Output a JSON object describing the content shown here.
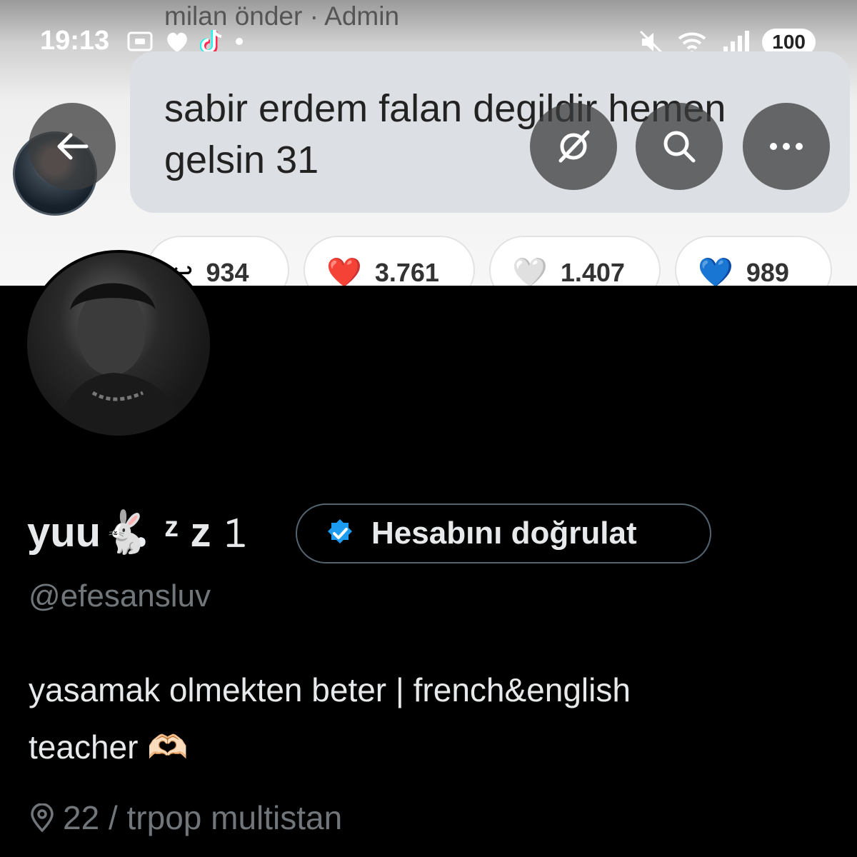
{
  "status_bar": {
    "time": "19:13",
    "battery": "100"
  },
  "banner": {
    "sender": "milan önder · Admin",
    "message": "sabir erdem falan degildir hemen gelsin 31",
    "reactions": [
      {
        "emoji": "↩",
        "count": "934"
      },
      {
        "emoji": "❤️",
        "count": "3.761"
      },
      {
        "emoji": "🤍",
        "count": "1.407"
      },
      {
        "emoji": "💙",
        "count": "989"
      }
    ]
  },
  "toolbar": {
    "back_icon": "back-arrow-icon",
    "grok_icon": "grok-icon",
    "search_icon": "search-icon",
    "more_icon": "more-icon"
  },
  "profile": {
    "display_name": "yuu🐇 ᶻ z 𝟷",
    "verify_label": "Hesabını doğrulat",
    "handle": "@efesansluv",
    "bio_line1": "yasamak olmekten beter | french&english",
    "bio_line2": "teacher 🫶🏻",
    "location": "22 / trpop multistan"
  },
  "colors": {
    "background": "#000000",
    "text_primary": "#e7e9ea",
    "text_secondary": "#71767b",
    "verified_blue": "#1d9bf0"
  }
}
